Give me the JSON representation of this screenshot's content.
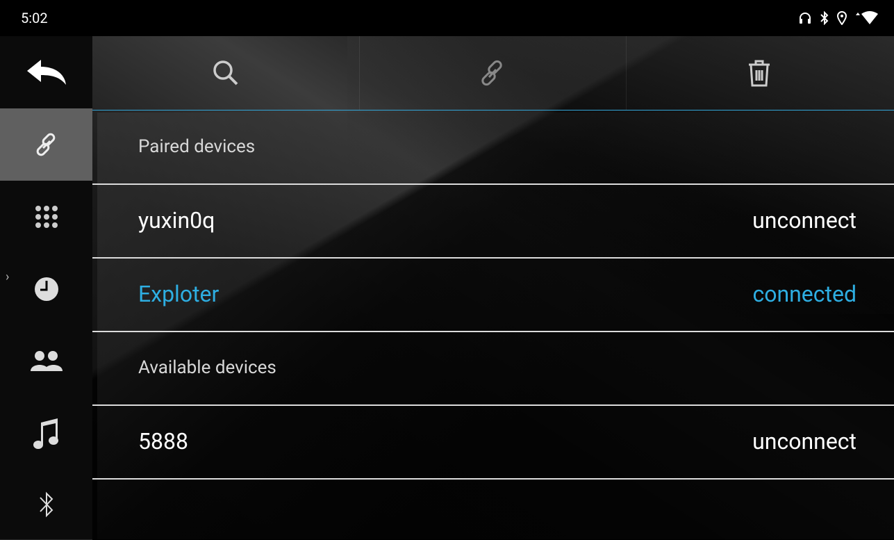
{
  "statusbar": {
    "time": "5:02",
    "icons": [
      "headphones-icon",
      "bluetooth-icon",
      "location-icon",
      "wifi-icon"
    ]
  },
  "sidebar": {
    "items": [
      {
        "name": "back",
        "icon": "back-arrow-icon",
        "active": false
      },
      {
        "name": "pair",
        "icon": "link-icon",
        "active": true
      },
      {
        "name": "dialpad",
        "icon": "dialpad-icon",
        "active": false
      },
      {
        "name": "recent",
        "icon": "clock-icon",
        "active": false
      },
      {
        "name": "contacts",
        "icon": "contacts-icon",
        "active": false
      },
      {
        "name": "music",
        "icon": "music-icon",
        "active": false
      },
      {
        "name": "bluetooth",
        "icon": "bluetooth-icon",
        "active": false
      }
    ]
  },
  "toolbar": {
    "buttons": [
      {
        "name": "search",
        "icon": "search-icon"
      },
      {
        "name": "connect",
        "icon": "link-icon"
      },
      {
        "name": "delete",
        "icon": "trash-icon"
      }
    ],
    "accent_color": "#33a6d8"
  },
  "paired_section": {
    "label": "Paired devices"
  },
  "paired_devices": [
    {
      "name": "yuxin0q",
      "status": "unconnect"
    },
    {
      "name": "Exploter",
      "status": "connected"
    }
  ],
  "available_section": {
    "label": "Available devices"
  },
  "available_devices": [
    {
      "name": "5888",
      "status": "unconnect"
    }
  ],
  "colors": {
    "connected": "#2eaee2",
    "text": "#ffffff",
    "sidebar_active": "#606060"
  }
}
